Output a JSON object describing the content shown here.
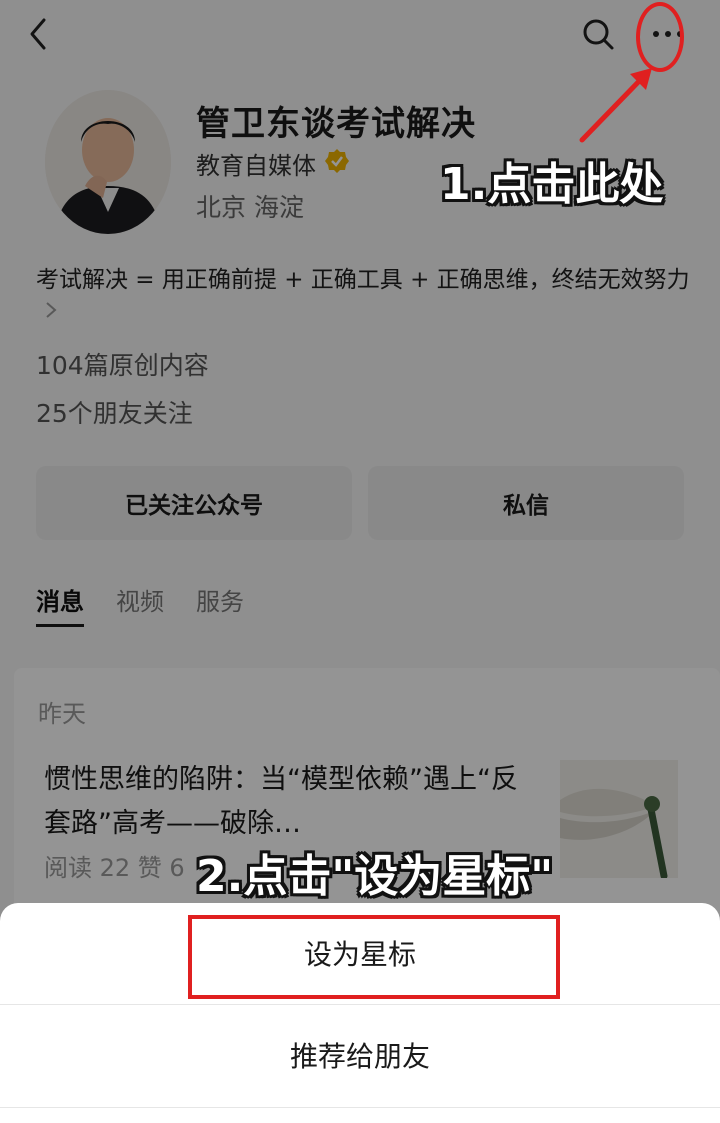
{
  "profile": {
    "name": "管卫东谈考试解决",
    "category": "教育自媒体",
    "location": "北京 海淀",
    "bio": "考试解决 = 用正确前提 + 正确工具 + 正确思维，终结无效努力",
    "original_count": "104篇原创内容",
    "friends_following": "25个朋友关注"
  },
  "actions": {
    "follow_label": "已关注公众号",
    "message_label": "私信"
  },
  "tabs": [
    {
      "label": "消息",
      "active": true
    },
    {
      "label": "视频",
      "active": false
    },
    {
      "label": "服务",
      "active": false
    }
  ],
  "feed": {
    "date": "昨天",
    "article": {
      "title": "惯性思维的陷阱：当“模型依赖”遇上“反套路”高考——破除…",
      "meta": "阅读 22  赞 6"
    }
  },
  "sheet": {
    "items": [
      "设为星标",
      "推荐给朋友"
    ]
  },
  "annotations": {
    "step1": "1.点击此处",
    "step2": "2.点击\"设为星标\""
  },
  "icons": {
    "back": "back-arrow-icon",
    "search": "search-icon",
    "more": "more-dots-icon",
    "verified": "verified-badge-icon"
  },
  "colors": {
    "highlight": "#e02020",
    "verified": "#f0b400"
  }
}
